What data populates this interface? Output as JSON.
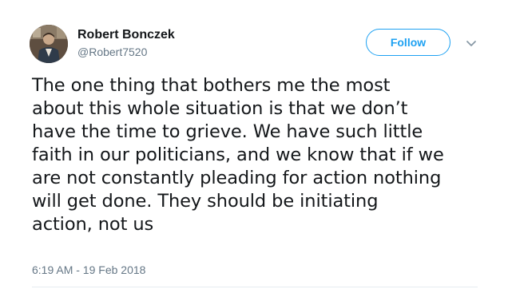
{
  "user": {
    "display_name": "Robert Bonczek",
    "handle": "@Robert7520"
  },
  "actions": {
    "follow_label": "Follow"
  },
  "tweet": {
    "text": "The one thing that bothers me the most\nabout this whole situation is that we don’t\nhave the time to grieve. We have such little\nfaith in our politicians, and we know that if we\nare not constantly pleading for action nothing\nwill get done. They should be initiating\naction, not us",
    "timestamp": "6:19 AM - 19 Feb 2018"
  },
  "icons": {
    "avatar": "profile-photo",
    "menu": "chevron-down-icon"
  },
  "colors": {
    "accent": "#1da1f2",
    "text": "#14171a",
    "muted": "#657786",
    "divider": "#e6ecf0"
  }
}
